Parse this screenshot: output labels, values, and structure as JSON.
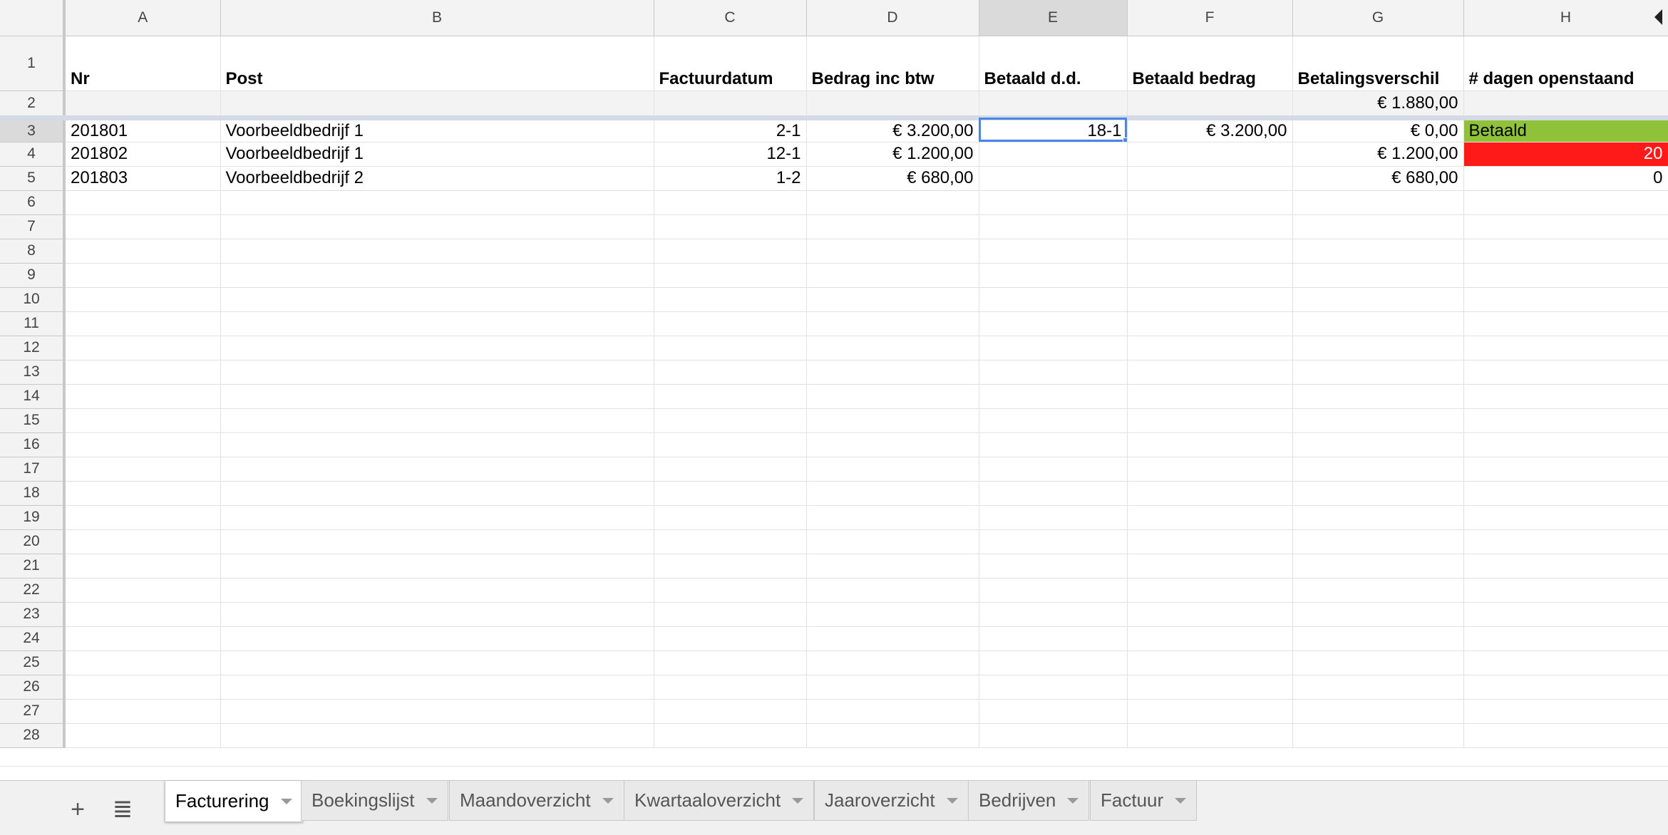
{
  "columns": [
    "A",
    "B",
    "C",
    "D",
    "E",
    "F",
    "G",
    "H"
  ],
  "selected_column": "E",
  "headers": {
    "nr": "Nr",
    "post": "Post",
    "factuurdatum": "Factuurdatum",
    "bedrag": "Bedrag inc btw",
    "betaald_dd": "Betaald d.d.",
    "betaald_bedrag": "Betaald bedrag",
    "verschil": "Betalingsverschil",
    "dagen": "# dagen openstaand"
  },
  "totals_row": {
    "verschil_total": "€ 1.880,00"
  },
  "rows": [
    {
      "nr": "201801",
      "post": "Voorbeeldbedrijf 1",
      "factuurdatum": "2-1",
      "bedrag": "€ 3.200,00",
      "betaald_dd": "18-1",
      "betaald_bedrag": "€ 3.200,00",
      "verschil": "€ 0,00",
      "dagen": "Betaald",
      "status_color": "#8fc239"
    },
    {
      "nr": "201802",
      "post": "Voorbeeldbedrijf 1",
      "factuurdatum": "12-1",
      "bedrag": "€ 1.200,00",
      "betaald_dd": "",
      "betaald_bedrag": "",
      "verschil": "€ 1.200,00",
      "dagen": "20",
      "status_color": "#ff1a1a"
    },
    {
      "nr": "201803",
      "post": "Voorbeeldbedrijf 2",
      "factuurdatum": "1-2",
      "bedrag": "€ 680,00",
      "betaald_dd": "",
      "betaald_bedrag": "",
      "verschil": "€ 680,00",
      "dagen": "0",
      "status_color": ""
    }
  ],
  "row_numbers": [
    "1",
    "2",
    "3",
    "4",
    "5",
    "6",
    "7",
    "8",
    "9",
    "10",
    "11",
    "12",
    "13",
    "14",
    "15",
    "16",
    "17",
    "18",
    "19",
    "20",
    "21",
    "22",
    "23",
    "24",
    "25",
    "26",
    "27",
    "28"
  ],
  "active_cell": "E3",
  "tabs": [
    {
      "label": "Facturering",
      "active": true
    },
    {
      "label": "Boekingslijst",
      "active": false
    },
    {
      "label": "Maandoverzicht",
      "active": false
    },
    {
      "label": "Kwartaaloverzicht",
      "active": false
    },
    {
      "label": "Jaaroverzicht",
      "active": false
    },
    {
      "label": "Bedrijven",
      "active": false
    },
    {
      "label": "Factuur",
      "active": false
    }
  ],
  "icons": {
    "add_sheet": "plus-icon",
    "all_sheets": "list-icon",
    "scroll": "caret-left-icon"
  }
}
